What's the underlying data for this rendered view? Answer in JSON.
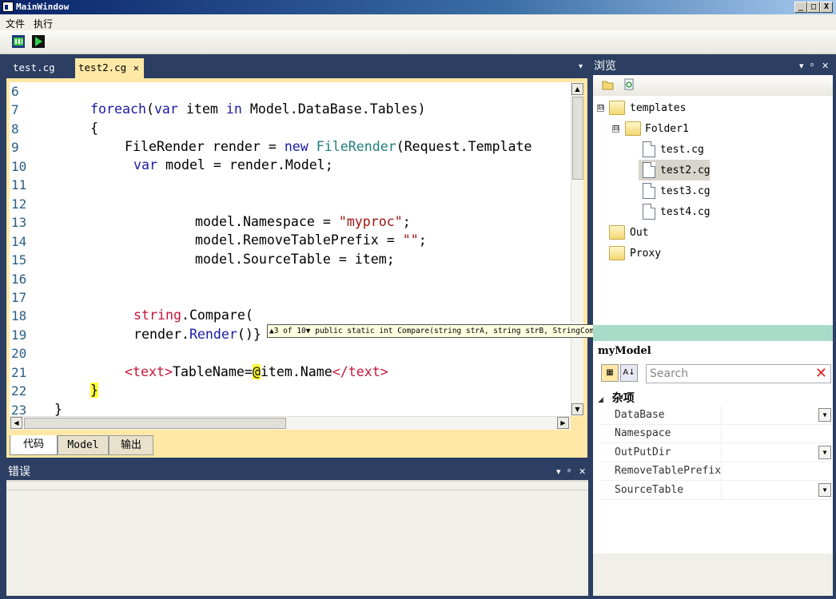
{
  "window": {
    "title": "MainWindow",
    "controls": {
      "minimize": "_",
      "maximize": "□",
      "close": "X"
    }
  },
  "menu": {
    "items": [
      "文件",
      "执行"
    ]
  },
  "toolbar": {
    "icons": [
      "debug-icon",
      "run-icon"
    ]
  },
  "editor_tabs": [
    {
      "label": "test.cg",
      "active": false
    },
    {
      "label": "test2.cg",
      "active": true,
      "close": "✕"
    }
  ],
  "tab_menu_glyph": "▾",
  "editor": {
    "line_numbers": [
      "6",
      "7",
      "8",
      "9",
      "10",
      "11",
      "12",
      "13",
      "14",
      "15",
      "16",
      "17",
      "18",
      "19",
      "20",
      "21",
      "22",
      "23"
    ],
    "lines": {
      "l7a": "foreach",
      "l7b": "(",
      "l7c": "var",
      "l7d": " item ",
      "l7e": "in",
      "l7f": " Model.DataBase.Tables)",
      "l8": "{",
      "l9a": "FileRender",
      "l9b": " render = ",
      "l9c": "new",
      "l9d": " ",
      "l9e": "FileRender",
      "l9f": "(Request.Template",
      "l10a": "var",
      "l10b": " model = render.Model;",
      "l13a": "model.Namespace = ",
      "l13b": "\"myproc\"",
      "l13c": ";",
      "l14a": "model.RemoveTablePrefix = ",
      "l14b": "\"\"",
      "l14c": ";",
      "l15": "model.SourceTable = item;",
      "l18a": "string",
      "l18b": ".Compare(",
      "l19a": "render.",
      "l19b": "Render",
      "l19c": "()",
      "l19d": "}",
      "l21a": "<text>",
      "l21b": "TableName=",
      "l21c": "@",
      "l21d": "item.Name",
      "l21e": "</text>",
      "l22": "}",
      "l23": "}"
    },
    "tooltip": {
      "up": "▲",
      "counter": "3 of 10",
      "down": "▼",
      "signature": "public static int Compare(string strA, string strB, StringComparison comparisonType)"
    }
  },
  "bottom_tabs": [
    {
      "label": "代码",
      "selected": true
    },
    {
      "label": "Model",
      "selected": false
    },
    {
      "label": "输出",
      "selected": false
    }
  ],
  "error_panel": {
    "title": "错误",
    "buttons": {
      "menu": "▾",
      "pin": "ᵖ",
      "close": "✕"
    }
  },
  "browse_panel": {
    "title": "浏览",
    "buttons": {
      "menu": "▾",
      "pin": "ᵖ",
      "close": "✕"
    },
    "tree": [
      {
        "label": "templates",
        "type": "folder",
        "expander": "⊟"
      },
      {
        "label": "Folder1",
        "type": "folder",
        "expander": "⊟"
      },
      {
        "label": "test.cg",
        "type": "file"
      },
      {
        "label": "test2.cg",
        "type": "file",
        "selected": true
      },
      {
        "label": "test3.cg",
        "type": "file"
      },
      {
        "label": "test4.cg",
        "type": "file"
      },
      {
        "label": "Out",
        "type": "folder"
      },
      {
        "label": "Proxy",
        "type": "folder"
      }
    ]
  },
  "properties": {
    "object_name": "myModel",
    "search_placeholder": "Search",
    "search_clear": "✕",
    "category": "杂项",
    "category_glyph": "◢",
    "rows": [
      {
        "name": "DataBase",
        "dropdown": true
      },
      {
        "name": "Namespace",
        "dropdown": false
      },
      {
        "name": "OutPutDir",
        "dropdown": true
      },
      {
        "name": "RemoveTablePrefix",
        "dropdown": false
      },
      {
        "name": "SourceTable",
        "dropdown": true
      }
    ]
  }
}
